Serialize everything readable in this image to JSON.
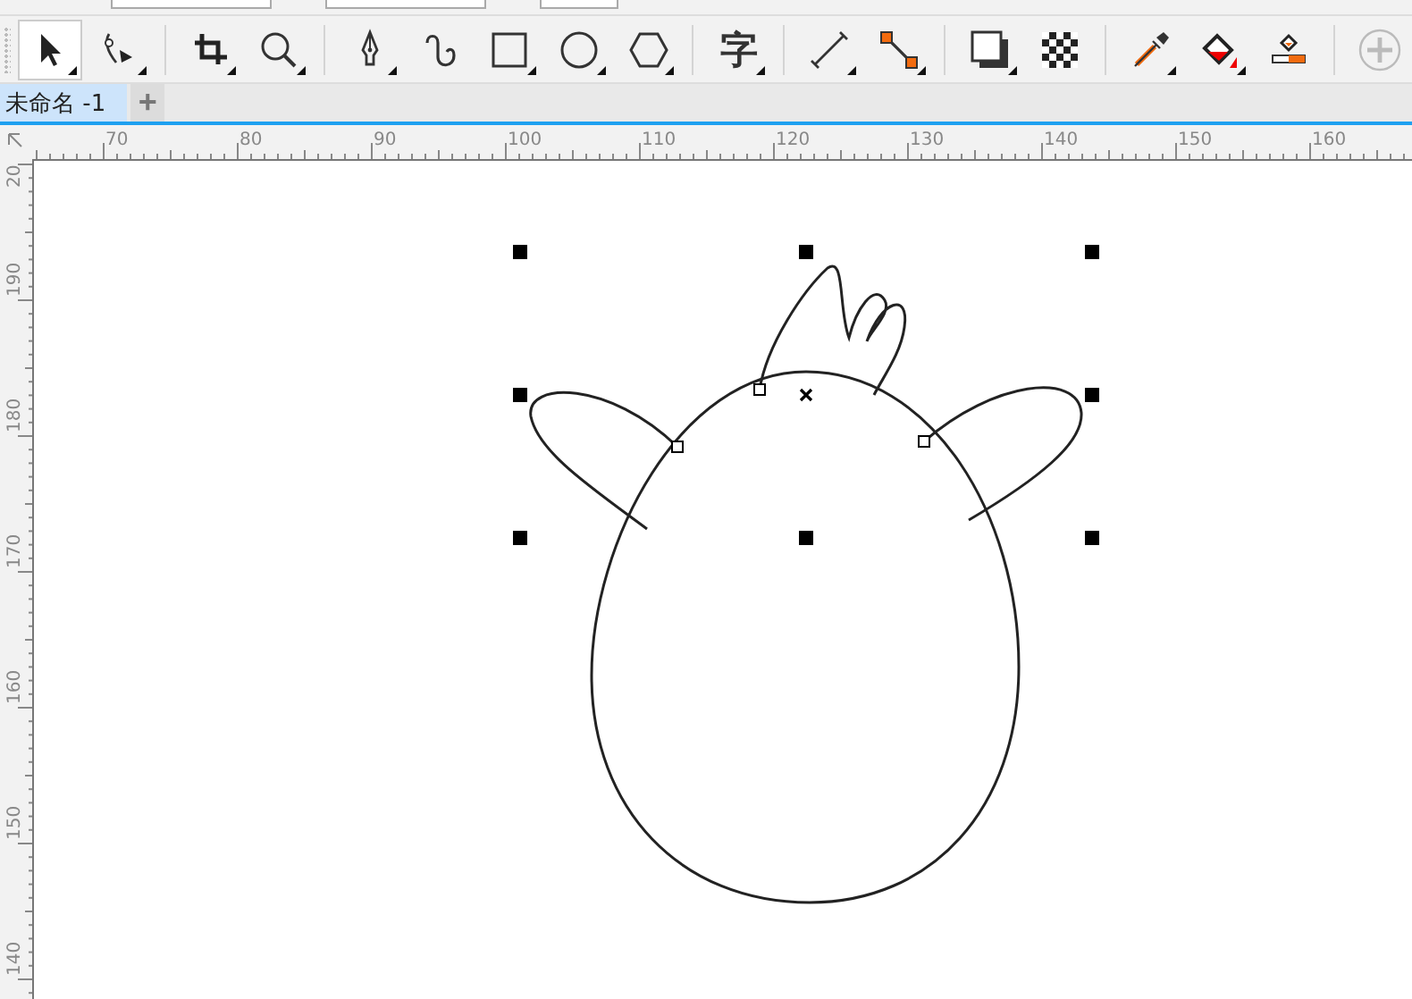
{
  "property_bar": {
    "fields": [
      {
        "kind": "wide"
      },
      {
        "kind": "wide"
      },
      {
        "kind": "narrow"
      }
    ]
  },
  "toolbox": [
    {
      "kind": "pick",
      "selected": true,
      "flyout": true
    },
    {
      "kind": "shape",
      "selected": false,
      "flyout": true
    },
    {
      "kind": "separator"
    },
    {
      "kind": "crop",
      "selected": false,
      "flyout": true
    },
    {
      "kind": "zoom",
      "selected": false,
      "flyout": true
    },
    {
      "kind": "separator"
    },
    {
      "kind": "pen",
      "selected": false,
      "flyout": true
    },
    {
      "kind": "freehand",
      "selected": false,
      "flyout": false
    },
    {
      "kind": "rectangle",
      "selected": false,
      "flyout": true
    },
    {
      "kind": "ellipse",
      "selected": false,
      "flyout": true
    },
    {
      "kind": "polygon",
      "selected": false,
      "flyout": true
    },
    {
      "kind": "separator"
    },
    {
      "kind": "text",
      "label": "字",
      "selected": false,
      "flyout": true
    },
    {
      "kind": "separator"
    },
    {
      "kind": "dimension",
      "selected": false,
      "flyout": true
    },
    {
      "kind": "connector",
      "selected": false,
      "flyout": true
    },
    {
      "kind": "separator"
    },
    {
      "kind": "shadow",
      "selected": false,
      "flyout": true
    },
    {
      "kind": "transparency",
      "selected": false,
      "flyout": false
    },
    {
      "kind": "separator"
    },
    {
      "kind": "eyedropper",
      "selected": false,
      "flyout": true
    },
    {
      "kind": "fill",
      "selected": false,
      "flyout": true
    },
    {
      "kind": "smartfill",
      "selected": false,
      "flyout": false
    },
    {
      "kind": "separator"
    },
    {
      "kind": "add",
      "selected": false,
      "flyout": false
    }
  ],
  "document_tabs": [
    {
      "label": "未命名 -1",
      "selected": true
    }
  ],
  "add_tab": "+",
  "horizontal_ruler": [
    "70",
    "80",
    "90",
    "100",
    "110",
    "120",
    "130",
    "140",
    "150",
    "160"
  ],
  "vertical_ruler": [
    "20",
    "190",
    "180",
    "170",
    "160",
    "150",
    "140"
  ]
}
